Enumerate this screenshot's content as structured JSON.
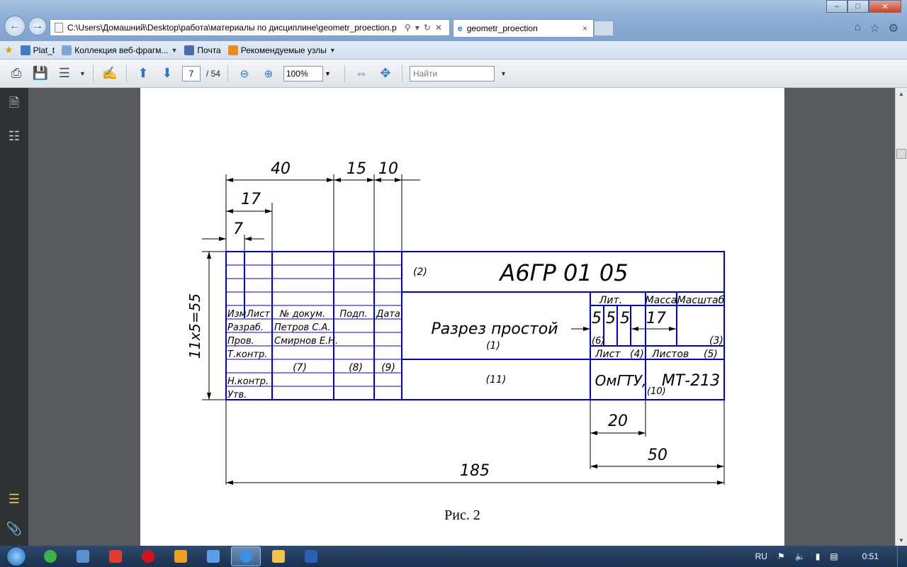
{
  "browser": {
    "address": "C:\\Users\\Домашний\\Desktop\\работа\\материалы по дисциплине\\geometr_proection.p",
    "tab_title": "geometr_proection",
    "tab_close": "×",
    "window_buttons": {
      "minimize": "–",
      "maximize": "□",
      "close": "✕"
    }
  },
  "favorites": {
    "items": [
      {
        "label": "Plat_t"
      },
      {
        "label": "Коллекция веб-фрагм..."
      },
      {
        "label": "Почта"
      },
      {
        "label": "Рекомендуемые узлы"
      }
    ]
  },
  "pdf_toolbar": {
    "page_current": "7",
    "page_total": "/ 54",
    "zoom": "100%",
    "find_placeholder": "Найти"
  },
  "document": {
    "caption": "Рис. 2",
    "drawing": {
      "dims": {
        "d40": "40",
        "d15": "15",
        "d10": "10",
        "d17": "17",
        "d7": "7",
        "height": "11x5=55",
        "d20": "20",
        "d50": "50",
        "d185": "185",
        "d17b": "17",
        "lit5a": "5",
        "lit5b": "5",
        "lit5c": "5"
      },
      "table": {
        "h_izm": "Изм",
        "h_list": "Лист",
        "h_doc": "№ докум.",
        "h_podp": "Подп.",
        "h_data": "Дата",
        "r_razrab": "Разраб.",
        "r_razrab_name": "Петров С.А.",
        "r_prov": "Пров.",
        "r_prov_name": "Смирнов Е.Н.",
        "r_tkontr": "Т.контр.",
        "r_nkontr": "Н.контр.",
        "r_utv": "Утв.",
        "m7": "(7)",
        "m8": "(8)",
        "m9": "(9)"
      },
      "title_block": {
        "m2": "(2)",
        "designation": "А6ГР 01 05",
        "name": "Разрез простой",
        "m1": "(1)",
        "lit": "Лит.",
        "massa": "Масса",
        "masshtab": "Масштаб",
        "m6": "(6)",
        "m3": "(3)",
        "list": "Лист",
        "m4": "(4)",
        "listov": "Листов",
        "m5": "(5)",
        "m11": "(11)",
        "org": "ОмГТУ,",
        "m10": "(10)",
        "group": "МТ-213"
      }
    }
  },
  "taskbar": {
    "lang": "RU",
    "time": "0:51"
  },
  "colors": {
    "frame_blue": "#0000cc",
    "page_bg": "#ffffff",
    "viewer_bg": "#585b5e"
  }
}
